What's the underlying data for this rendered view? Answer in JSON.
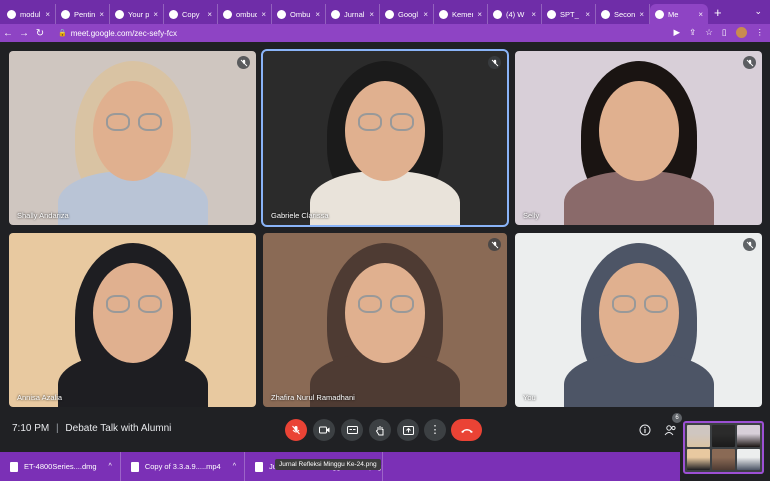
{
  "browser": {
    "tabs": [
      {
        "label": "modul",
        "icon": "doc-icon"
      },
      {
        "label": "Pentin",
        "icon": "chat-icon"
      },
      {
        "label": "Your p",
        "icon": "google-icon"
      },
      {
        "label": "Copy",
        "icon": "google-icon"
      },
      {
        "label": "ombud",
        "icon": "google-icon"
      },
      {
        "label": "Ombu",
        "icon": "chrome-icon"
      },
      {
        "label": "Jurnal",
        "icon": "chat-icon"
      },
      {
        "label": "Googl",
        "icon": "drive-icon"
      },
      {
        "label": "Kemer",
        "icon": "site-icon"
      },
      {
        "label": "(4) W",
        "icon": "whatsapp-icon"
      },
      {
        "label": "SPT_",
        "icon": "e-icon"
      },
      {
        "label": "Secon",
        "icon": "site-icon"
      },
      {
        "label": "Me",
        "icon": "meet-icon",
        "active": true
      }
    ],
    "url": "meet.google.com/zec-sefy-fcx"
  },
  "participants": [
    {
      "name": "Shally Andariza",
      "muted": true,
      "bg": "#cfc6c0",
      "hijab": "#d9c3a3",
      "shirt": "#b9c4d6"
    },
    {
      "name": "Gabriele Clarissa",
      "muted": true,
      "bg": "#2b2b2b",
      "hijab": "#1b1b1b",
      "shirt": "#e9e3da"
    },
    {
      "name": "Selly",
      "muted": true,
      "bg": "#d8cfd8",
      "hijab": "#1a1412",
      "shirt": "#8a6a6a"
    },
    {
      "name": "Annisa Azalia",
      "muted": false,
      "bg": "#e8c9a0",
      "hijab": "#1e1e22",
      "shirt": "#1e1e22"
    },
    {
      "name": "Zhafira Nurul Ramadhani",
      "muted": true,
      "bg": "#8a6a55",
      "hijab": "#4e3b33",
      "shirt": "#4e3b33"
    },
    {
      "name": "You",
      "muted": true,
      "bg": "#eceeee",
      "hijab": "#4d5566",
      "shirt": "#4d5566"
    }
  ],
  "meeting": {
    "time": "7:10 PM",
    "separator": "|",
    "title": "Debate Talk with Alumni",
    "people_count": "6"
  },
  "downloads": [
    {
      "name": "ET-4800Series....dmg"
    },
    {
      "name": "Copy of 3.3.a.9.....mp4"
    },
    {
      "name": "Jurnal Refleksi Minggu Ke-24.png"
    }
  ],
  "tooltip": "Jurnal Refleksi Minggu Ke-24.png",
  "colors": {
    "browser_chrome": "#6f2da8",
    "meet_background": "#202124",
    "end_call": "#ea4335",
    "active_speaker": "#8ab4f8"
  }
}
